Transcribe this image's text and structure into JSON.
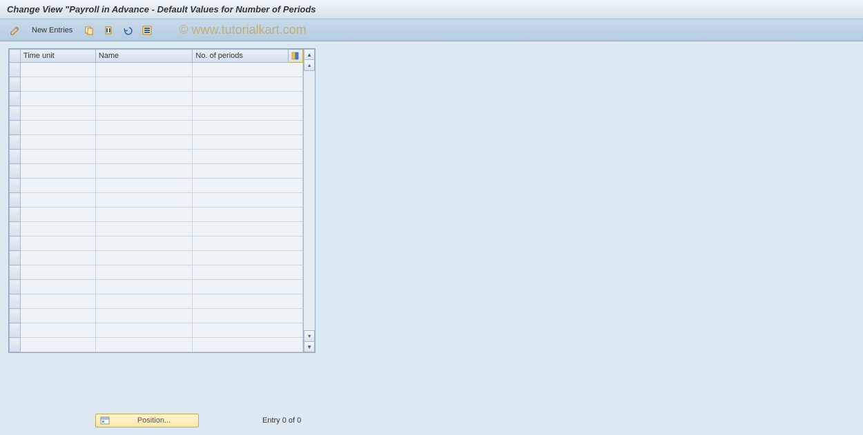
{
  "title": "Change View \"Payroll in Advance - Default Values for Number of Periods",
  "toolbar": {
    "new_entries_label": "New Entries"
  },
  "watermark": "© www.tutorialkart.com",
  "table": {
    "columns": {
      "time_unit": "Time unit",
      "name": "Name",
      "no_of_periods": "No. of periods"
    },
    "row_count": 20
  },
  "footer": {
    "position_label": "Position...",
    "entry_status": "Entry 0 of 0"
  }
}
